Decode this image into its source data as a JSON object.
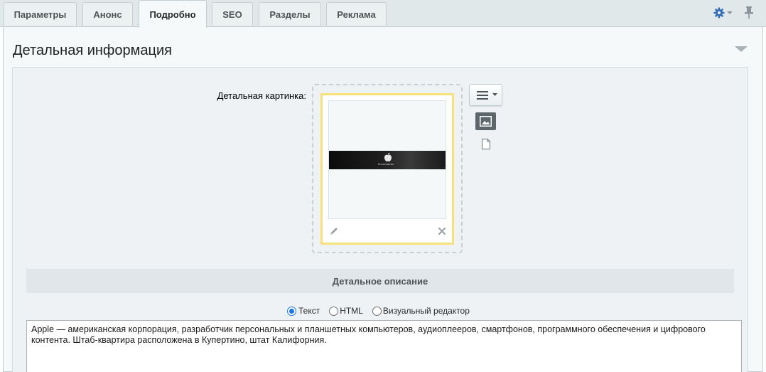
{
  "tabs": [
    {
      "label": "Параметры",
      "active": false
    },
    {
      "label": "Анонс",
      "active": false
    },
    {
      "label": "Подробно",
      "active": true
    },
    {
      "label": "SEO",
      "active": false
    },
    {
      "label": "Разделы",
      "active": false
    },
    {
      "label": "Реклама",
      "active": false
    }
  ],
  "toolbar": {
    "gear_icon": "gear-icon",
    "pin_icon": "pin-icon",
    "accent": "#2f6db6"
  },
  "section": {
    "title": "Детальная информация"
  },
  "detail_picture": {
    "label": "Детальная картинка:",
    "banner_text": "Ilovamaster",
    "highlight_color": "#f7e17b"
  },
  "description": {
    "header": "Детальное описание",
    "modes": [
      {
        "label": "Текст",
        "selected": true
      },
      {
        "label": "HTML",
        "selected": false
      },
      {
        "label": "Визуальный редактор",
        "selected": false
      }
    ],
    "text": "Apple  — американская корпорация, разработчик персональных и планшетных компьютеров, аудиоплееров, смартфонов, программного обеспечения и цифрового контента. Штаб-квартира расположена в Купертино, штат Калифорния."
  }
}
